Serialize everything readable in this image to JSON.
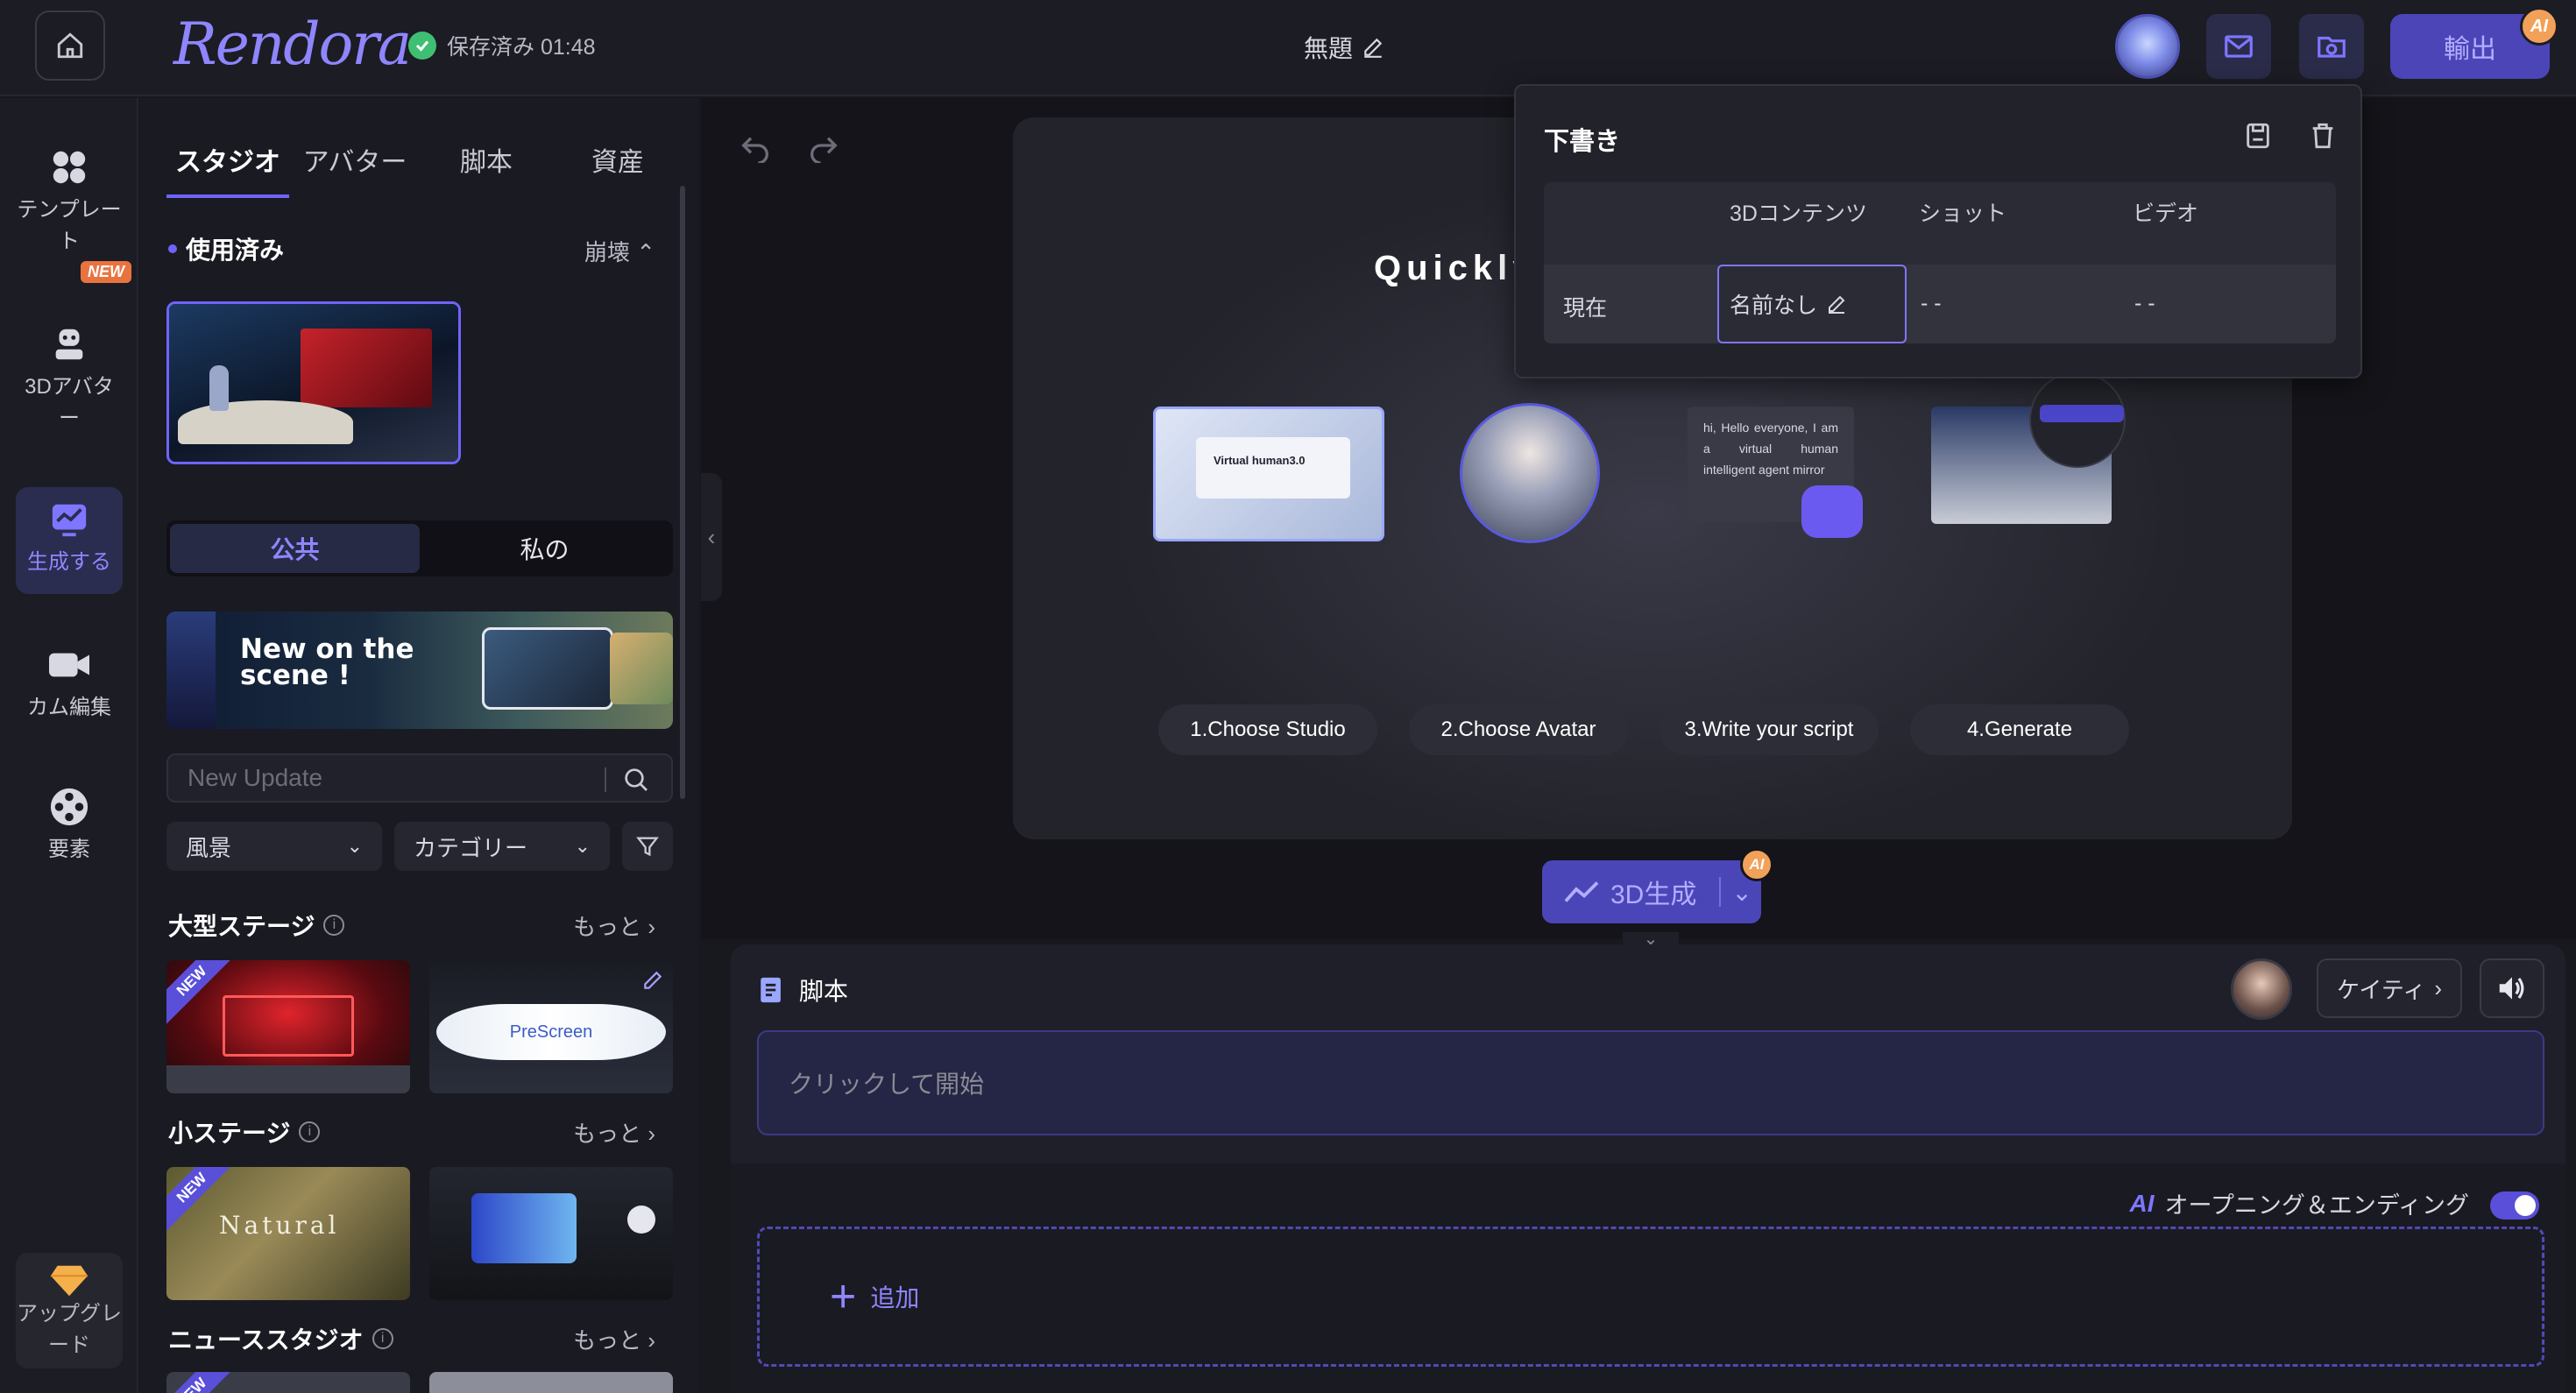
{
  "header": {
    "logo": "Rendora",
    "saved_status": "保存済み 01:48",
    "doc_title": "無題",
    "export_label": "輸出",
    "ai_badge": "AI"
  },
  "rail": {
    "items": [
      {
        "label": "テンプレート",
        "icon": "grid-icon"
      },
      {
        "label": "3Dアバター",
        "icon": "robot-icon"
      },
      {
        "label": "生成する",
        "icon": "chart-icon"
      },
      {
        "label": "カム編集",
        "icon": "video-camera-icon"
      },
      {
        "label": "要素",
        "icon": "film-reel-icon"
      }
    ],
    "new_tag": "NEW",
    "upgrade_label": "アップグレード"
  },
  "panel": {
    "tabs": [
      "スタジオ",
      "アバター",
      "脚本",
      "資産"
    ],
    "used_section": "使用済み",
    "collapse_label": "崩壊",
    "segments": [
      "公共",
      "私の"
    ],
    "banner_text": "New on the scene !",
    "search_placeholder": "New Update",
    "filter_scene": "風景",
    "filter_category": "カテゴリー",
    "sections": [
      {
        "title": "大型ステージ",
        "more": "もっと"
      },
      {
        "title": "小ステージ",
        "more": "もっと"
      },
      {
        "title": "ニューススタジオ",
        "more": "もっと"
      }
    ],
    "new_corner": "NEW",
    "thumb_natural_text": "Natural",
    "thumb_prescreen_text": "PreScreen"
  },
  "preview": {
    "headline": "Quickly",
    "steps": [
      "1.Choose Studio",
      "2.Choose Avatar",
      "3.Write your script",
      "4.Generate"
    ],
    "script_card_text": "hi, Hello everyone, I am a virtual human intelligent agent mirror",
    "studio_card_text": "Virtual human3.0"
  },
  "gen3d": {
    "label": "3D生成",
    "ai_badge": "AI"
  },
  "script": {
    "title": "脚本",
    "voice_name": "ケイティ",
    "placeholder": "クリックして開始"
  },
  "bottom": {
    "opening_label": "オープニング＆エンディング",
    "add_label": "追加"
  },
  "draft": {
    "title": "下書き",
    "columns": [
      "3Dコンテンツ",
      "ショット",
      "ビデオ"
    ],
    "row_label": "現在",
    "row_name": "名前なし",
    "row_shot": "- -",
    "row_video": "- -"
  },
  "colors": {
    "accent": "#6e64ff",
    "accent_light": "#8f86ff",
    "saved_green": "#3fbf72",
    "new_orange": "#e9733f"
  }
}
